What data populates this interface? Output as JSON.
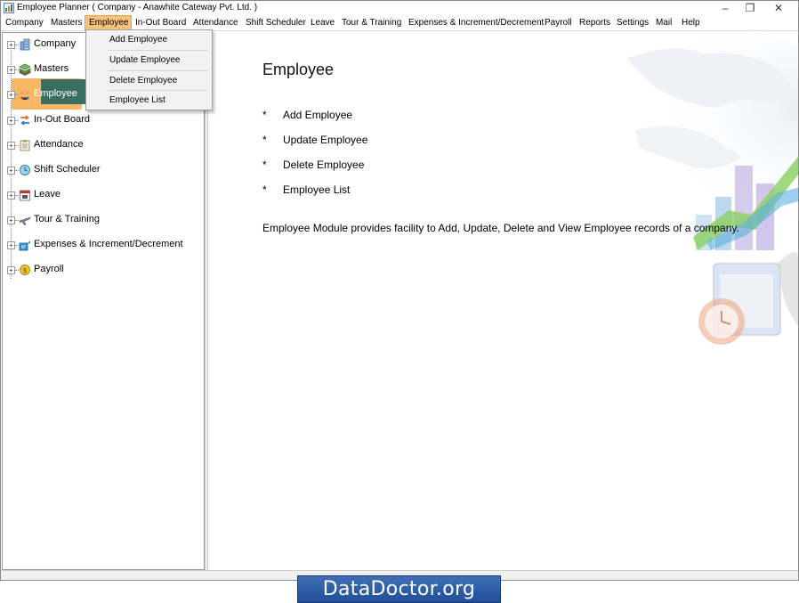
{
  "window": {
    "title": "Employee Planner ( Company - Anawhite Cateway Pvt. Ltd. )",
    "controls": {
      "minimize": "–",
      "maximize": "❐",
      "close": "✕"
    }
  },
  "menubar": {
    "items": [
      {
        "label": "Company"
      },
      {
        "label": "Masters"
      },
      {
        "label": "Employee",
        "active": true
      },
      {
        "label": "In-Out Board"
      },
      {
        "label": "Attendance"
      },
      {
        "label": "Shift Scheduler"
      },
      {
        "label": "Leave"
      },
      {
        "label": "Tour & Training"
      },
      {
        "label": "Expenses & Increment/Decrement"
      },
      {
        "label": "Payroll"
      },
      {
        "label": "Reports"
      },
      {
        "label": "Settings"
      },
      {
        "label": "Mail"
      },
      {
        "label": "Help"
      }
    ]
  },
  "dropdown": {
    "items": [
      {
        "label": "Add Employee"
      },
      {
        "label": "Update Employee"
      },
      {
        "label": "Delete Employee"
      },
      {
        "label": "Employee List"
      }
    ]
  },
  "sidebar": {
    "expander_symbol": "+",
    "items": [
      {
        "label": "Company",
        "icon": "building-icon"
      },
      {
        "label": "Masters",
        "icon": "stack-icon"
      },
      {
        "label": "Employee",
        "icon": "people-icon",
        "selected": true
      },
      {
        "label": "In-Out Board",
        "icon": "in-out-arrows-icon"
      },
      {
        "label": "Attendance",
        "icon": "clipboard-icon"
      },
      {
        "label": "Shift Scheduler",
        "icon": "clock-globe-icon"
      },
      {
        "label": "Leave",
        "icon": "calendar-icon"
      },
      {
        "label": "Tour & Training",
        "icon": "airplane-icon"
      },
      {
        "label": "Expenses & Increment/Decrement",
        "icon": "expenses-icon"
      },
      {
        "label": "Payroll",
        "icon": "coin-icon"
      }
    ]
  },
  "content": {
    "title": "Employee",
    "bullet_symbol": "*",
    "bullets": [
      "Add Employee",
      "Update Employee",
      "Delete Employee",
      "Employee List"
    ],
    "description": "Employee Module provides facility to Add, Update, Delete and View Employee records of a company."
  },
  "watermark": "DataDoctor.org",
  "colors": {
    "menu_active": "#f7c27d",
    "selection_outer": "#f7b765",
    "selection_inner": "#3a6e62",
    "watermark_bg": "#2f5fa6"
  }
}
